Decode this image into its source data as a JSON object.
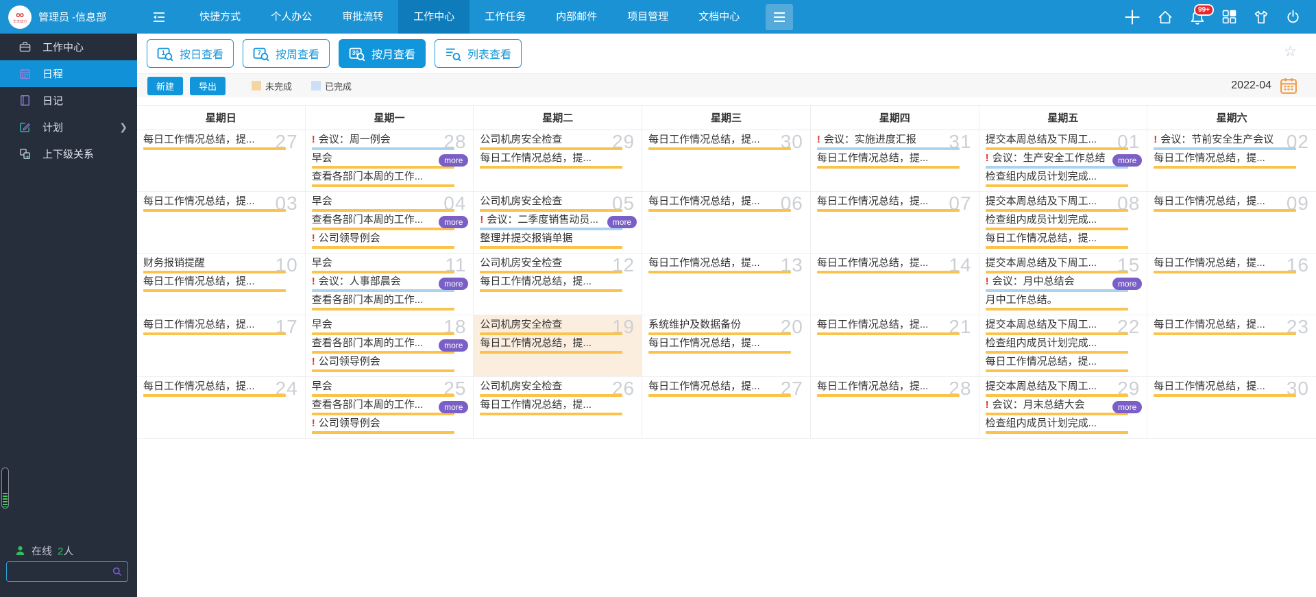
{
  "topbar": {
    "user": "管理员 -信息部",
    "logo_text": "∞",
    "logo_subtext": "华天动力",
    "menu": [
      "快捷方式",
      "个人办公",
      "审批流转",
      "工作中心",
      "工作任务",
      "内部邮件",
      "项目管理",
      "文档中心"
    ],
    "active_index": 3,
    "right_icons": [
      "plus-icon",
      "home-icon",
      "bell-icon",
      "apps-icon",
      "theme-icon",
      "power-icon"
    ],
    "bell_badge": "99+"
  },
  "sidebar": {
    "items": [
      {
        "label": "工作中心",
        "icon": "briefcase-icon",
        "active": false,
        "chevron": false
      },
      {
        "label": "日程",
        "icon": "calendar-icon",
        "active": true,
        "chevron": false
      },
      {
        "label": "日记",
        "icon": "diary-icon",
        "active": false,
        "chevron": false
      },
      {
        "label": "计划",
        "icon": "plan-icon",
        "active": false,
        "chevron": true
      },
      {
        "label": "上下级关系",
        "icon": "relation-icon",
        "active": false,
        "chevron": false
      }
    ],
    "online_label": "在线",
    "online_count": "2",
    "online_unit": "人",
    "search_placeholder": ""
  },
  "view_tabs": [
    {
      "label": "按日查看",
      "icon": "calendar-day-search-icon",
      "digit": "1",
      "active": false
    },
    {
      "label": "按周查看",
      "icon": "calendar-week-search-icon",
      "digit": "7",
      "active": false
    },
    {
      "label": "按月查看",
      "icon": "calendar-month-search-icon",
      "digit": "30",
      "active": true
    },
    {
      "label": "列表查看",
      "icon": "list-search-icon",
      "digit": "",
      "active": false
    }
  ],
  "toolbar": {
    "new_label": "新建",
    "export_label": "导出",
    "legend_incomplete": "未完成",
    "legend_complete": "已完成",
    "month": "2022-04"
  },
  "calendar": {
    "weekdays": [
      "星期日",
      "星期一",
      "星期二",
      "星期三",
      "星期四",
      "星期五",
      "星期六"
    ],
    "more_label": "more",
    "weeks": [
      [
        {
          "date": "27",
          "events": [
            {
              "text": "每日工作情况总结，提...",
              "status": "incomplete",
              "important": false
            }
          ],
          "more": false,
          "today": false
        },
        {
          "date": "28",
          "events": [
            {
              "text": "会议：周一例会",
              "status": "complete",
              "important": true
            },
            {
              "text": "早会",
              "status": "incomplete",
              "important": false
            },
            {
              "text": "查看各部门本周的工作...",
              "status": "incomplete",
              "important": false
            }
          ],
          "more": true,
          "today": false
        },
        {
          "date": "29",
          "events": [
            {
              "text": "公司机房安全检查",
              "status": "incomplete",
              "important": false
            },
            {
              "text": "每日工作情况总结，提...",
              "status": "incomplete",
              "important": false
            }
          ],
          "more": false,
          "today": false
        },
        {
          "date": "30",
          "events": [
            {
              "text": "每日工作情况总结，提...",
              "status": "incomplete",
              "important": false
            }
          ],
          "more": false,
          "today": false
        },
        {
          "date": "31",
          "events": [
            {
              "text": "会议：实施进度汇报",
              "status": "complete",
              "important": true
            },
            {
              "text": "每日工作情况总结，提...",
              "status": "incomplete",
              "important": false
            }
          ],
          "more": false,
          "today": false
        },
        {
          "date": "01",
          "events": [
            {
              "text": "提交本周总结及下周工...",
              "status": "incomplete",
              "important": false
            },
            {
              "text": "会议：生产安全工作总结",
              "status": "complete",
              "important": true
            },
            {
              "text": "检查组内成员计划完成...",
              "status": "incomplete",
              "important": false
            }
          ],
          "more": true,
          "today": false
        },
        {
          "date": "02",
          "events": [
            {
              "text": "会议：节前安全生产会议",
              "status": "complete",
              "important": true
            },
            {
              "text": "每日工作情况总结，提...",
              "status": "incomplete",
              "important": false
            }
          ],
          "more": false,
          "today": false
        }
      ],
      [
        {
          "date": "03",
          "events": [
            {
              "text": "每日工作情况总结，提...",
              "status": "incomplete",
              "important": false
            }
          ],
          "more": false,
          "today": false
        },
        {
          "date": "04",
          "events": [
            {
              "text": "早会",
              "status": "incomplete",
              "important": false
            },
            {
              "text": "查看各部门本周的工作...",
              "status": "incomplete",
              "important": false
            },
            {
              "text": "公司领导例会",
              "status": "incomplete",
              "important": true
            }
          ],
          "more": true,
          "today": false
        },
        {
          "date": "05",
          "events": [
            {
              "text": "公司机房安全检查",
              "status": "incomplete",
              "important": false
            },
            {
              "text": "会议：二季度销售动员...",
              "status": "complete",
              "important": true
            },
            {
              "text": "整理并提交报销单据",
              "status": "incomplete",
              "important": false
            }
          ],
          "more": true,
          "today": false
        },
        {
          "date": "06",
          "events": [
            {
              "text": "每日工作情况总结，提...",
              "status": "incomplete",
              "important": false
            }
          ],
          "more": false,
          "today": false
        },
        {
          "date": "07",
          "events": [
            {
              "text": "每日工作情况总结，提...",
              "status": "incomplete",
              "important": false
            }
          ],
          "more": false,
          "today": false
        },
        {
          "date": "08",
          "events": [
            {
              "text": "提交本周总结及下周工...",
              "status": "incomplete",
              "important": false
            },
            {
              "text": "检查组内成员计划完成...",
              "status": "incomplete",
              "important": false
            },
            {
              "text": "每日工作情况总结，提...",
              "status": "incomplete",
              "important": false
            }
          ],
          "more": false,
          "today": false
        },
        {
          "date": "09",
          "events": [
            {
              "text": "每日工作情况总结，提...",
              "status": "incomplete",
              "important": false
            }
          ],
          "more": false,
          "today": false
        }
      ],
      [
        {
          "date": "10",
          "events": [
            {
              "text": "财务报销提醒",
              "status": "incomplete",
              "important": false
            },
            {
              "text": "每日工作情况总结，提...",
              "status": "incomplete",
              "important": false
            }
          ],
          "more": false,
          "today": false
        },
        {
          "date": "11",
          "events": [
            {
              "text": "早会",
              "status": "incomplete",
              "important": false
            },
            {
              "text": "会议：人事部晨会",
              "status": "complete",
              "important": true
            },
            {
              "text": "查看各部门本周的工作...",
              "status": "incomplete",
              "important": false
            }
          ],
          "more": true,
          "today": false
        },
        {
          "date": "12",
          "events": [
            {
              "text": "公司机房安全检查",
              "status": "incomplete",
              "important": false
            },
            {
              "text": "每日工作情况总结，提...",
              "status": "incomplete",
              "important": false
            }
          ],
          "more": false,
          "today": false
        },
        {
          "date": "13",
          "events": [
            {
              "text": "每日工作情况总结，提...",
              "status": "incomplete",
              "important": false
            }
          ],
          "more": false,
          "today": false
        },
        {
          "date": "14",
          "events": [
            {
              "text": "每日工作情况总结，提...",
              "status": "incomplete",
              "important": false
            }
          ],
          "more": false,
          "today": false
        },
        {
          "date": "15",
          "events": [
            {
              "text": "提交本周总结及下周工...",
              "status": "incomplete",
              "important": false
            },
            {
              "text": "会议：月中总结会",
              "status": "complete",
              "important": true
            },
            {
              "text": "月中工作总结。",
              "status": "incomplete",
              "important": false
            }
          ],
          "more": true,
          "today": false
        },
        {
          "date": "16",
          "events": [
            {
              "text": "每日工作情况总结，提...",
              "status": "incomplete",
              "important": false
            }
          ],
          "more": false,
          "today": false
        }
      ],
      [
        {
          "date": "17",
          "events": [
            {
              "text": "每日工作情况总结，提...",
              "status": "incomplete",
              "important": false
            }
          ],
          "more": false,
          "today": false
        },
        {
          "date": "18",
          "events": [
            {
              "text": "早会",
              "status": "incomplete",
              "important": false
            },
            {
              "text": "查看各部门本周的工作...",
              "status": "incomplete",
              "important": false
            },
            {
              "text": "公司领导例会",
              "status": "incomplete",
              "important": true
            }
          ],
          "more": true,
          "today": false
        },
        {
          "date": "19",
          "events": [
            {
              "text": "公司机房安全检查",
              "status": "incomplete",
              "important": false
            },
            {
              "text": "每日工作情况总结，提...",
              "status": "incomplete",
              "important": false
            }
          ],
          "more": false,
          "today": true
        },
        {
          "date": "20",
          "events": [
            {
              "text": "系统维护及数据备份",
              "status": "incomplete",
              "important": false
            },
            {
              "text": "每日工作情况总结，提...",
              "status": "incomplete",
              "important": false
            }
          ],
          "more": false,
          "today": false
        },
        {
          "date": "21",
          "events": [
            {
              "text": "每日工作情况总结，提...",
              "status": "incomplete",
              "important": false
            }
          ],
          "more": false,
          "today": false
        },
        {
          "date": "22",
          "events": [
            {
              "text": "提交本周总结及下周工...",
              "status": "incomplete",
              "important": false
            },
            {
              "text": "检查组内成员计划完成...",
              "status": "incomplete",
              "important": false
            },
            {
              "text": "每日工作情况总结，提...",
              "status": "incomplete",
              "important": false
            }
          ],
          "more": false,
          "today": false
        },
        {
          "date": "23",
          "events": [
            {
              "text": "每日工作情况总结，提...",
              "status": "incomplete",
              "important": false
            }
          ],
          "more": false,
          "today": false
        }
      ],
      [
        {
          "date": "24",
          "events": [
            {
              "text": "每日工作情况总结，提...",
              "status": "incomplete",
              "important": false
            }
          ],
          "more": false,
          "today": false
        },
        {
          "date": "25",
          "events": [
            {
              "text": "早会",
              "status": "incomplete",
              "important": false
            },
            {
              "text": "查看各部门本周的工作...",
              "status": "incomplete",
              "important": false
            },
            {
              "text": "公司领导例会",
              "status": "incomplete",
              "important": true
            }
          ],
          "more": true,
          "today": false
        },
        {
          "date": "26",
          "events": [
            {
              "text": "公司机房安全检查",
              "status": "incomplete",
              "important": false
            },
            {
              "text": "每日工作情况总结，提...",
              "status": "incomplete",
              "important": false
            }
          ],
          "more": false,
          "today": false
        },
        {
          "date": "27",
          "events": [
            {
              "text": "每日工作情况总结，提...",
              "status": "incomplete",
              "important": false
            }
          ],
          "more": false,
          "today": false
        },
        {
          "date": "28",
          "events": [
            {
              "text": "每日工作情况总结，提...",
              "status": "incomplete",
              "important": false
            }
          ],
          "more": false,
          "today": false
        },
        {
          "date": "29",
          "events": [
            {
              "text": "提交本周总结及下周工...",
              "status": "incomplete",
              "important": false
            },
            {
              "text": "会议：月末总结大会",
              "status": "incomplete",
              "important": true
            },
            {
              "text": "检查组内成员计划完成...",
              "status": "incomplete",
              "important": false
            }
          ],
          "more": true,
          "today": false
        },
        {
          "date": "30",
          "events": [
            {
              "text": "每日工作情况总结，提...",
              "status": "incomplete",
              "important": false
            }
          ],
          "more": false,
          "today": false
        }
      ]
    ]
  },
  "colors": {
    "topbar": "#1b92d4",
    "topbar_active": "#0e7bbb",
    "sidebar": "#262d3b",
    "accent_blue": "#1296db",
    "incomplete_bar": "#fbc34c",
    "complete_bar": "#a9d3ef",
    "today_bg": "#fceede",
    "more_badge": "#7a5fc7",
    "badge_red": "#e8262d"
  }
}
